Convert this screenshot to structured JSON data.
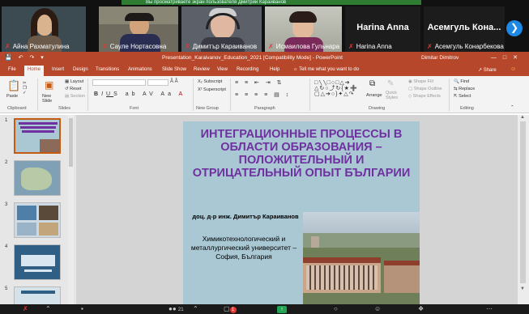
{
  "zoom": {
    "banner_text": "Вы просматриваете экран пользователя Дмитрий Караиванов",
    "participants": [
      {
        "name": "Айна Рахматулина",
        "muted": true
      },
      {
        "name": "Сауле Нортасовна",
        "muted": true
      },
      {
        "name": "Димитър Караиванов",
        "muted": true
      },
      {
        "name": "Исмаилова Гульнара",
        "muted": true
      },
      {
        "name": "Harina Anna",
        "muted": true
      },
      {
        "name": "Асемгуль Конарбекова",
        "muted": true
      }
    ],
    "large_names": [
      "Harina Anna",
      "Асемгуль Кона..."
    ],
    "next_icon": "chevron-right-icon",
    "toolbar": {
      "participants_count": "21",
      "chat_badge": "1",
      "share_icon": "share-screen-icon"
    }
  },
  "powerpoint": {
    "window_title": "Presentation_Karaivanov_Education_2021 [Compatibility Mode] - PowerPoint",
    "user": "Dimitar Dimitrov",
    "tabs": [
      "File",
      "Home",
      "Insert",
      "Design",
      "Transitions",
      "Animations",
      "Slide Show",
      "Review",
      "View",
      "Recording",
      "Help"
    ],
    "active_tab": "Home",
    "tell_me": "Tell me what you want to do",
    "share": "Share",
    "ribbon": {
      "paste": "Paste",
      "new_slide": "New Slide",
      "layout": "Layout",
      "reset": "Reset",
      "section": "Section",
      "subscript": "Subscript",
      "superscript": "Superscript",
      "arrange": "Arrange",
      "quick_styles": "Quick Styles",
      "shape_fill": "Shape Fill",
      "shape_outline": "Shape Outline",
      "shape_effects": "Shape Effects",
      "find": "Find",
      "replace": "Replace",
      "select": "Select",
      "groups": {
        "clipboard": "Clipboard",
        "slides": "Slides",
        "font": "Font",
        "new_group": "New Group",
        "paragraph": "Paragraph",
        "drawing": "Drawing",
        "editing": "Editing"
      }
    },
    "thumbnail_numbers": [
      "1",
      "2",
      "3",
      "4",
      "5"
    ],
    "slide": {
      "title": "ИНТЕГРАЦИОННЫЕ ПРОЦЕССЫ В ОБЛАСТИ  ОБРАЗОВАНИЯ – ПОЛОЖИТЕЛЬНЫЙ И ОТРИЦАТЕЛЬНЫЙ ОПЫТ БЪЛГАРИИ",
      "author": "доц. д-р инж. Димитър Караиванов",
      "institution": "Химикотехнологический и металлургический университет – София, България"
    }
  }
}
